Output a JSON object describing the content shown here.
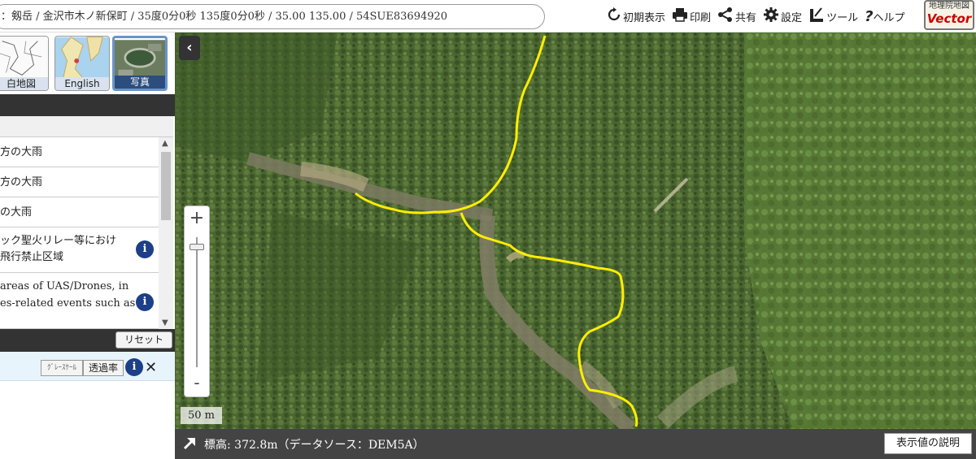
{
  "header": {
    "address": "：剱岳 / 金沢市木ノ新保町 / 35度0分0秒 135度0分0秒 / 35.00 135.00 / 54SUE83694920",
    "toolbar": [
      {
        "label": "初期表示",
        "icon": "reload-icon"
      },
      {
        "label": "印刷",
        "icon": "printer-icon"
      },
      {
        "label": "共有",
        "icon": "share-icon"
      },
      {
        "label": "設定",
        "icon": "gear-icon"
      },
      {
        "label": "ツール",
        "icon": "tool-icon"
      },
      {
        "label": "ヘルプ",
        "icon": "help-icon"
      }
    ],
    "logo_line1": "地理院地図",
    "logo_line2": "Vector"
  },
  "basemaps": [
    {
      "label": "白地図",
      "selected": false
    },
    {
      "label": "English",
      "selected": false
    },
    {
      "label": "写真",
      "selected": true
    }
  ],
  "layers": [
    {
      "text1": "方の大雨",
      "text2": "",
      "info": false
    },
    {
      "text1": "方の大雨",
      "text2": "",
      "info": false
    },
    {
      "text1": "の大雨",
      "text2": "",
      "info": false
    },
    {
      "text1": "ック聖火リレー等におけ",
      "text2": "飛行禁止区域",
      "info": true
    },
    {
      "text1": "areas of UAS/Drones, in",
      "text2": "es-related events such as",
      "info": true
    }
  ],
  "info_icon": "i",
  "reset_label": "リセット",
  "selected_layer": {
    "grayscale_label": "ｸﾞﾚｰｽｹｰﾙ",
    "transparency_label": "透過率",
    "info": "i",
    "close": "✕"
  },
  "map": {
    "collapse": "‹",
    "zoom_in": "+",
    "zoom_out": "-",
    "zoom_level_fraction": 0.05,
    "scale": "50 m",
    "route_color": "#ffee00"
  },
  "bottom": {
    "elevation": "標高: 372.8m（データソース：DEM5A）",
    "explain_label": "表示値の説明"
  }
}
